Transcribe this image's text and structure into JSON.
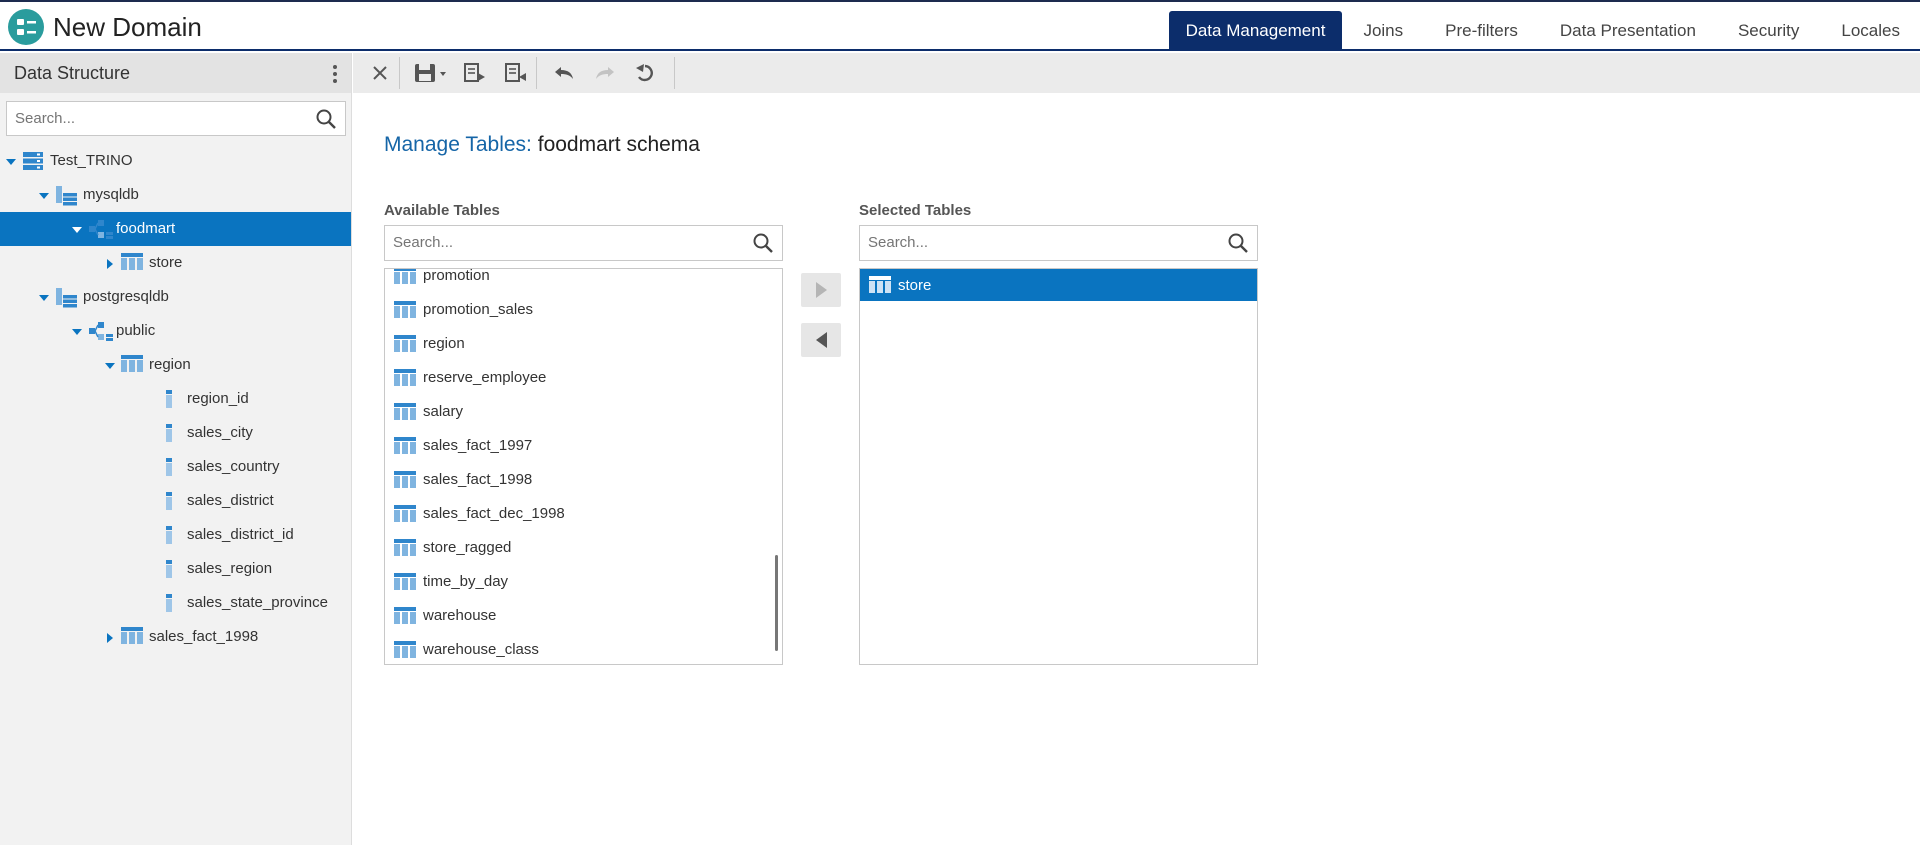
{
  "header": {
    "title": "New Domain",
    "tabs": [
      {
        "label": "Data Management",
        "active": true
      },
      {
        "label": "Joins",
        "active": false
      },
      {
        "label": "Pre-filters",
        "active": false
      },
      {
        "label": "Data Presentation",
        "active": false
      },
      {
        "label": "Security",
        "active": false
      },
      {
        "label": "Locales",
        "active": false
      }
    ]
  },
  "sidebar": {
    "title": "Data Structure",
    "search_placeholder": "Search...",
    "tree": [
      {
        "label": "Test_TRINO",
        "icon": "server-icon",
        "expanded": true
      },
      {
        "label": "mysqldb",
        "icon": "database-icon",
        "expanded": true
      },
      {
        "label": "foodmart",
        "icon": "schema-icon",
        "expanded": true,
        "selected": true
      },
      {
        "label": "store",
        "icon": "table-icon",
        "expanded": false
      },
      {
        "label": "postgresqldb",
        "icon": "database-icon",
        "expanded": true
      },
      {
        "label": "public",
        "icon": "schema-icon",
        "expanded": true
      },
      {
        "label": "region",
        "icon": "table-icon",
        "expanded": true
      },
      {
        "label": "region_id",
        "icon": "field-icon"
      },
      {
        "label": "sales_city",
        "icon": "field-icon"
      },
      {
        "label": "sales_country",
        "icon": "field-icon"
      },
      {
        "label": "sales_district",
        "icon": "field-icon"
      },
      {
        "label": "sales_district_id",
        "icon": "field-icon"
      },
      {
        "label": "sales_region",
        "icon": "field-icon"
      },
      {
        "label": "sales_state_province",
        "icon": "field-icon"
      },
      {
        "label": "sales_fact_1998",
        "icon": "table-icon",
        "expanded": false
      }
    ]
  },
  "main": {
    "title_prefix": "Manage Tables:",
    "title_schema": "foodmart schema",
    "available": {
      "label": "Available Tables",
      "search_placeholder": "Search...",
      "items": [
        "promotion",
        "promotion_sales",
        "region",
        "reserve_employee",
        "salary",
        "sales_fact_1997",
        "sales_fact_1998",
        "sales_fact_dec_1998",
        "store_ragged",
        "time_by_day",
        "warehouse",
        "warehouse_class"
      ]
    },
    "selected": {
      "label": "Selected Tables",
      "search_placeholder": "Search...",
      "items": [
        "store"
      ]
    }
  },
  "colors": {
    "accent": "#0a74c0",
    "nav_active": "#0c2d6b",
    "icon_blue": "#3f95d6",
    "logo": "#2a9c9d"
  }
}
